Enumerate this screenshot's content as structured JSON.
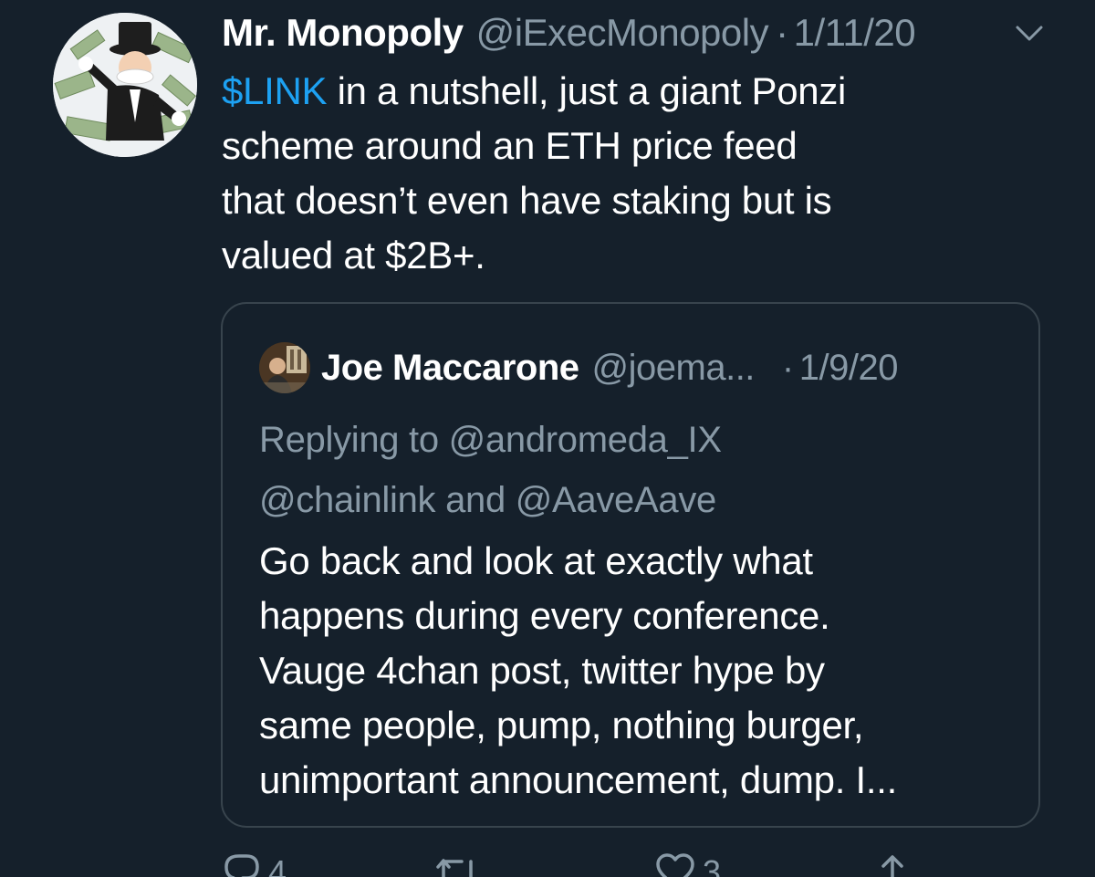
{
  "tweet": {
    "name": "Mr. Monopoly",
    "handle": "@iExecMonopoly",
    "separator": "·",
    "date": "1/11/20",
    "cashtag": "$LINK",
    "line1_rest": " in a nutshell, just a giant Ponzi",
    "line2": "scheme around an ETH price feed",
    "line3": "that doesn’t even have staking but is",
    "line4": "valued at $2B+."
  },
  "quote": {
    "name": "Joe Maccarone",
    "handle": "@joema...",
    "separator": "·",
    "date": "1/9/20",
    "replying_line1": "Replying to @andromeda_IX",
    "replying_line2": "@chainlink and @AaveAave",
    "line1": "Go back and look at exactly what",
    "line2": "happens during every conference.",
    "line3": "Vauge 4chan post, twitter hype by",
    "line4": "same people, pump, nothing burger,",
    "line5": "unimportant announcement, dump.  I..."
  },
  "actions": {
    "reply_count": "4",
    "retweet_count": "",
    "like_count": "3"
  },
  "colors": {
    "background": "#15202b",
    "accent": "#1da1f2",
    "muted": "#8899a6",
    "border": "#38444d"
  },
  "icons": [
    "avatar-image",
    "chevron-down-icon",
    "reply-icon",
    "retweet-icon",
    "like-icon",
    "share-icon"
  ]
}
